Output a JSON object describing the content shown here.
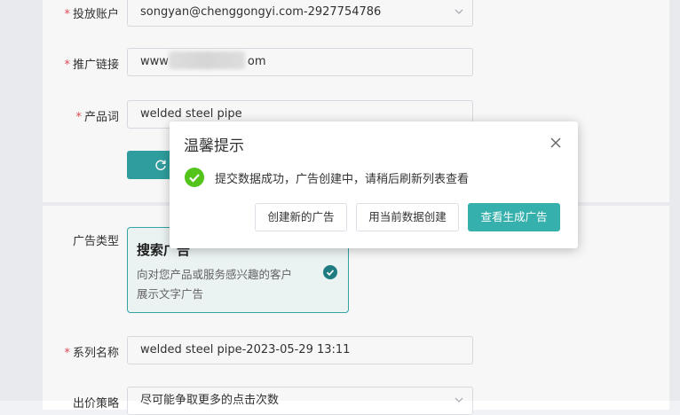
{
  "form": {
    "account": {
      "label": "投放账户",
      "value": "songyan@chenggongyi.com-2927754786"
    },
    "link": {
      "label": "推广链接",
      "value_prefix": "www",
      "value_suffix": "om"
    },
    "product": {
      "label": "产品词",
      "value": "welded steel pipe"
    },
    "ad_type": {
      "label": "广告类型",
      "option_title": "搜索广告",
      "option_desc": "向对您产品或服务感兴趣的客户展示文字广告"
    },
    "series": {
      "label": "系列名称",
      "value": "welded steel pipe-2023-05-29 13:11"
    },
    "bid": {
      "label": "出价策略",
      "value": "尽可能争取更多的点击次数"
    }
  },
  "modal": {
    "title": "温馨提示",
    "message": "提交数据成功，广告创建中，请稍后刷新列表查看",
    "buttons": {
      "create_new": "创建新的广告",
      "use_current": "用当前数据创建",
      "view_generated": "查看生成广告"
    }
  },
  "colors": {
    "primary": "#36b0ac",
    "success": "#52c41a",
    "required": "#e34d59"
  }
}
